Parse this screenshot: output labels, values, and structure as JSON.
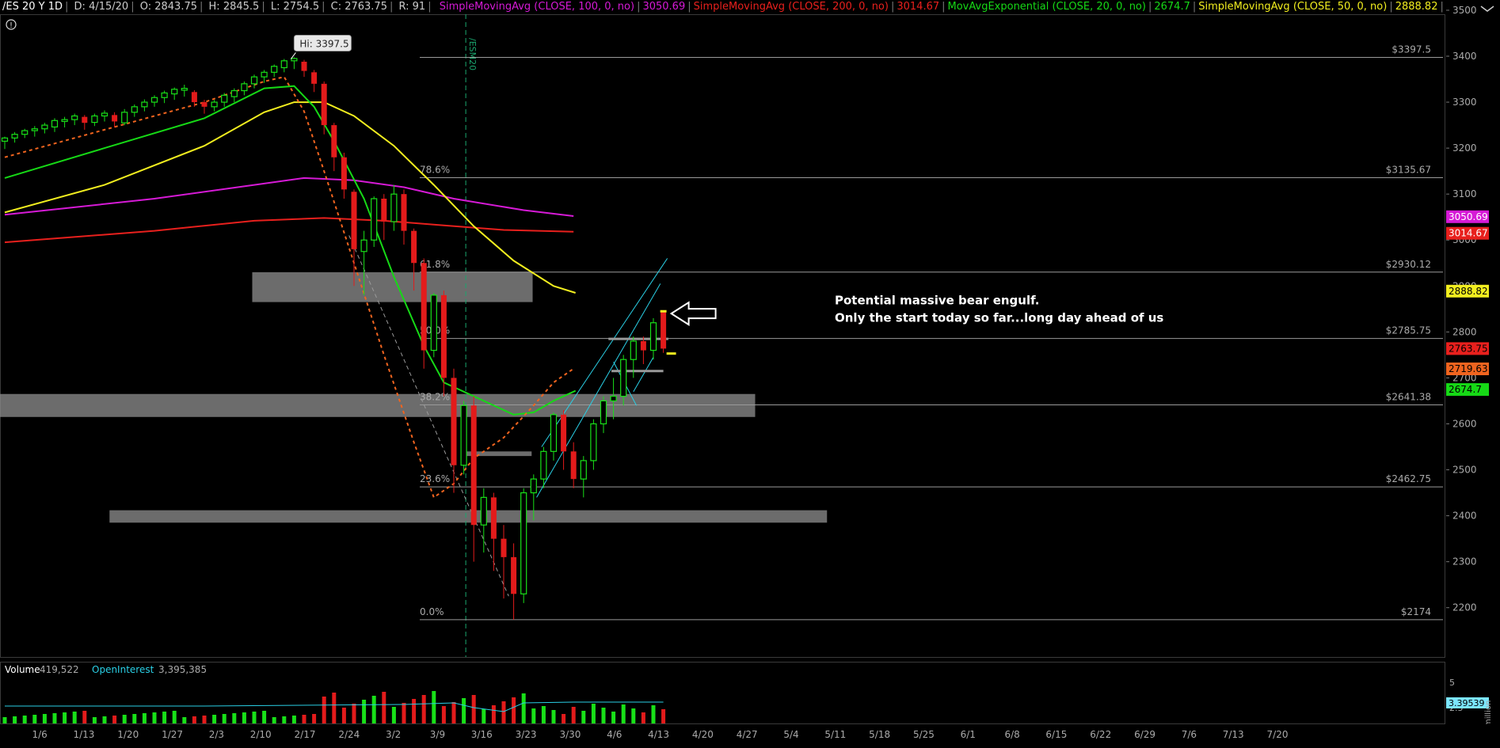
{
  "header": {
    "symbol": "/ES 20 Y 1D",
    "date": "D: 4/15/20",
    "open": "O: 2843.75",
    "high": "H: 2845.5",
    "low": "L: 2754.5",
    "close": "C: 2763.75",
    "range": "R: 91",
    "studies": [
      {
        "label": "SimpleMovingAvg (CLOSE, 100, 0, no)",
        "value": "3050.69",
        "color": "#d61ad6"
      },
      {
        "label": "SimpleMovingAvg (CLOSE, 200, 0, no)",
        "value": "3014.67",
        "color": "#e8201d"
      },
      {
        "label": "MovAvgExponential (CLOSE, 20, 0, no)",
        "value": "2674.7",
        "color": "#16d916"
      },
      {
        "label": "SimpleMovingAvg (CLOSE, 50, 0, no)",
        "value": "2888.82",
        "color": "#f2ee1f"
      },
      {
        "label": "MovAvgExponential (CLOSE, 8, 0, no)",
        "value": "2719.63",
        "color": "#f0641f"
      }
    ]
  },
  "chart_data": {
    "type": "candlestick",
    "x_ticks": [
      "1/6",
      "1/13",
      "1/20",
      "1/27",
      "2/3",
      "2/10",
      "2/17",
      "2/24",
      "3/2",
      "3/9",
      "3/16",
      "3/23",
      "3/30",
      "4/6",
      "4/13",
      "4/20",
      "4/27",
      "5/4",
      "5/11",
      "5/18",
      "5/25",
      "6/1",
      "6/8",
      "6/15",
      "6/22",
      "6/29",
      "7/6",
      "7/13",
      "7/20"
    ],
    "y_ticks": [
      2200,
      2300,
      2400,
      2500,
      2600,
      2700,
      2800,
      2900,
      3000,
      3100,
      3200,
      3300,
      3400,
      3500
    ],
    "ylim": [
      2140,
      3510
    ],
    "high_label": "Hi: 3397.5",
    "contract_label": "/ESM20",
    "fib_levels": [
      {
        "pct": "78.6%",
        "price": 3135.67,
        "label": "$3135.67"
      },
      {
        "pct": "61.8%",
        "price": 2930.12,
        "label": "$2930.12"
      },
      {
        "pct": "50.0%",
        "price": 2785.75,
        "label": "$2785.75"
      },
      {
        "pct": "38.2%",
        "price": 2641.38,
        "label": "$2641.38"
      },
      {
        "pct": "23.6%",
        "price": 2462.75,
        "label": "$2462.75"
      },
      {
        "pct": "0.0%",
        "price": 2174,
        "label": "$2174"
      },
      {
        "pct": "",
        "price": 3397.5,
        "label": "$3397.5"
      }
    ],
    "zones": [
      {
        "x0": 24.8,
        "x1": 52.9,
        "y0": 2865,
        "y1": 2930
      },
      {
        "x0": -0.6,
        "x1": 75.2,
        "y0": 2615,
        "y1": 2665
      },
      {
        "x0": 10.5,
        "x1": 82.4,
        "y0": 2385,
        "y1": 2412
      },
      {
        "x0": 46.1,
        "x1": 52.8,
        "y0": 2530,
        "y1": 2540
      }
    ],
    "price_labels": [
      {
        "text": "3050.69",
        "price": 3050.69,
        "bg": "#d61ad6",
        "fg": "#ffffff"
      },
      {
        "text": "3014.67",
        "price": 3014.67,
        "bg": "#e8201d",
        "fg": "#ffffff"
      },
      {
        "text": "2888.82",
        "price": 2888.82,
        "bg": "#f2ee1f",
        "fg": "#000000"
      },
      {
        "text": "2763.75",
        "price": 2763.75,
        "bg": "#e8201d",
        "fg": "#000000"
      },
      {
        "text": "2719.63",
        "price": 2719.63,
        "bg": "#f0641f",
        "fg": "#000000"
      },
      {
        "text": "2674.7",
        "price": 2674.7,
        "bg": "#16d916",
        "fg": "#000000"
      }
    ],
    "annotation": [
      "Potential massive bear engulf.",
      "Only the start today so far...long day ahead of us"
    ],
    "series": [
      {
        "name": "SMA 100",
        "color": "#d61ad6",
        "points": [
          [
            0,
            3055
          ],
          [
            15,
            3090
          ],
          [
            25,
            3120
          ],
          [
            30,
            3135
          ],
          [
            35,
            3130
          ],
          [
            40,
            3115
          ],
          [
            45,
            3090
          ],
          [
            52,
            3065
          ],
          [
            57,
            3052
          ]
        ]
      },
      {
        "name": "SMA 200",
        "color": "#e8201d",
        "points": [
          [
            0,
            2995
          ],
          [
            15,
            3020
          ],
          [
            25,
            3042
          ],
          [
            32,
            3048
          ],
          [
            38,
            3042
          ],
          [
            44,
            3032
          ],
          [
            50,
            3022
          ],
          [
            57,
            3018
          ]
        ]
      },
      {
        "name": "SMA 50",
        "color": "#f2ee1f",
        "points": [
          [
            0,
            3060
          ],
          [
            10,
            3120
          ],
          [
            20,
            3205
          ],
          [
            26,
            3278
          ],
          [
            29,
            3300
          ],
          [
            32,
            3300
          ],
          [
            35,
            3270
          ],
          [
            39,
            3205
          ],
          [
            43,
            3120
          ],
          [
            47,
            3030
          ],
          [
            51,
            2955
          ],
          [
            55,
            2900
          ],
          [
            57.2,
            2885
          ]
        ]
      },
      {
        "name": "EMA 20",
        "color": "#16d916",
        "points": [
          [
            0,
            3135
          ],
          [
            10,
            3200
          ],
          [
            20,
            3265
          ],
          [
            26,
            3330
          ],
          [
            29,
            3335
          ],
          [
            31,
            3290
          ],
          [
            33,
            3215
          ],
          [
            36,
            3090
          ],
          [
            39,
            2920
          ],
          [
            42,
            2770
          ],
          [
            44,
            2690
          ],
          [
            47,
            2660
          ],
          [
            51,
            2620
          ],
          [
            53,
            2625
          ],
          [
            55,
            2650
          ],
          [
            57.2,
            2672
          ]
        ]
      },
      {
        "name": "EMA 8",
        "color": "#f0641f",
        "points": [
          [
            0,
            3180
          ],
          [
            10,
            3240
          ],
          [
            20,
            3300
          ],
          [
            26,
            3345
          ],
          [
            28,
            3355
          ],
          [
            30,
            3280
          ],
          [
            32,
            3150
          ],
          [
            35,
            2950
          ],
          [
            38,
            2750
          ],
          [
            41,
            2560
          ],
          [
            43,
            2440
          ],
          [
            45,
            2470
          ],
          [
            47,
            2525
          ],
          [
            50,
            2570
          ],
          [
            53,
            2640
          ],
          [
            55,
            2690
          ],
          [
            57,
            2720
          ]
        ]
      }
    ],
    "candles": [
      [
        0,
        3215,
        3222,
        3205,
        3225,
        3198
      ],
      [
        1,
        3222,
        3230,
        3215,
        3235,
        3212
      ],
      [
        2,
        3230,
        3238,
        3226,
        3242,
        3222
      ],
      [
        3,
        3238,
        3242,
        3230,
        3248,
        3225
      ],
      [
        4,
        3242,
        3250,
        3238,
        3255,
        3232
      ],
      [
        5,
        3246,
        3260,
        3240,
        3265,
        3235
      ],
      [
        6,
        3258,
        3262,
        3250,
        3268,
        3245
      ],
      [
        7,
        3262,
        3270,
        3256,
        3275,
        3250
      ],
      [
        8,
        3268,
        3255,
        3248,
        3272,
        3240
      ],
      [
        9,
        3256,
        3270,
        3252,
        3275,
        3248
      ],
      [
        10,
        3270,
        3276,
        3262,
        3282,
        3258
      ],
      [
        11,
        3272,
        3258,
        3250,
        3278,
        3245
      ],
      [
        12,
        3255,
        3278,
        3252,
        3285,
        3250
      ],
      [
        13,
        3278,
        3290,
        3272,
        3295,
        3268
      ],
      [
        14,
        3290,
        3300,
        3284,
        3306,
        3280
      ],
      [
        15,
        3300,
        3310,
        3294,
        3315,
        3290
      ],
      [
        16,
        3310,
        3320,
        3303,
        3325,
        3298
      ],
      [
        17,
        3318,
        3328,
        3312,
        3332,
        3305
      ],
      [
        18,
        3326,
        3330,
        3318,
        3338,
        3312
      ],
      [
        19,
        3322,
        3300,
        3294,
        3326,
        3290
      ],
      [
        20,
        3300,
        3290,
        3280,
        3305,
        3275
      ],
      [
        21,
        3290,
        3300,
        3286,
        3305,
        3280
      ],
      [
        22,
        3300,
        3315,
        3296,
        3320,
        3290
      ],
      [
        23,
        3312,
        3325,
        3306,
        3330,
        3300
      ],
      [
        24,
        3325,
        3340,
        3320,
        3345,
        3315
      ],
      [
        25,
        3340,
        3355,
        3335,
        3360,
        3330
      ],
      [
        26,
        3355,
        3365,
        3348,
        3370,
        3342
      ],
      [
        27,
        3365,
        3378,
        3360,
        3382,
        3355
      ],
      [
        28,
        3375,
        3390,
        3370,
        3394,
        3365
      ],
      [
        29,
        3390,
        3395,
        3380,
        3397.5,
        3372
      ],
      [
        30,
        3388,
        3368,
        3360,
        3392,
        3355
      ],
      [
        31,
        3365,
        3340,
        3330,
        3370,
        3322
      ],
      [
        32,
        3340,
        3250,
        3240,
        3345,
        3230
      ],
      [
        33,
        3250,
        3180,
        3160,
        3255,
        3150
      ],
      [
        34,
        3180,
        3110,
        3100,
        3190,
        3090
      ],
      [
        35,
        3105,
        2980,
        2950,
        3110,
        2900
      ],
      [
        36,
        2975,
        3000,
        2960,
        3020,
        2880
      ],
      [
        37,
        3000,
        3090,
        2990,
        3095,
        2985
      ],
      [
        38,
        3090,
        3040,
        3010,
        3100,
        3000
      ],
      [
        39,
        3040,
        3100,
        3030,
        3120,
        3020
      ],
      [
        40,
        3100,
        3020,
        3000,
        3110,
        2990
      ],
      [
        41,
        3020,
        2950,
        2920,
        3025,
        2890
      ],
      [
        42,
        2950,
        2760,
        2740,
        2960,
        2720
      ],
      [
        43,
        2760,
        2880,
        2750,
        2885,
        2745
      ],
      [
        44,
        2880,
        2700,
        2680,
        2890,
        2660
      ],
      [
        45,
        2700,
        2510,
        2480,
        2720,
        2450
      ],
      [
        46,
        2510,
        2640,
        2500,
        2650,
        2490
      ],
      [
        47,
        2640,
        2380,
        2350,
        2660,
        2300
      ],
      [
        48,
        2380,
        2440,
        2330,
        2460,
        2320
      ],
      [
        49,
        2440,
        2350,
        2300,
        2450,
        2280
      ],
      [
        50,
        2350,
        2310,
        2230,
        2380,
        2220
      ],
      [
        51,
        2310,
        2230,
        2180,
        2340,
        2174
      ],
      [
        52,
        2230,
        2450,
        2220,
        2460,
        2210
      ],
      [
        53,
        2450,
        2480,
        2400,
        2490,
        2390
      ],
      [
        54,
        2480,
        2540,
        2470,
        2550,
        2460
      ],
      [
        55,
        2540,
        2620,
        2530,
        2625,
        2520
      ],
      [
        56,
        2620,
        2540,
        2510,
        2630,
        2500
      ],
      [
        57,
        2540,
        2480,
        2470,
        2560,
        2460
      ],
      [
        58,
        2480,
        2520,
        2460,
        2530,
        2440
      ],
      [
        59,
        2520,
        2600,
        2510,
        2610,
        2500
      ],
      [
        60,
        2600,
        2650,
        2590,
        2660,
        2580
      ],
      [
        61,
        2650,
        2660,
        2620,
        2700,
        2610
      ],
      [
        62,
        2660,
        2740,
        2650,
        2750,
        2640
      ],
      [
        63,
        2740,
        2780,
        2720,
        2790,
        2700
      ],
      [
        64,
        2780,
        2760,
        2740,
        2790,
        2730
      ],
      [
        65,
        2760,
        2820,
        2750,
        2830,
        2740
      ],
      [
        66,
        2843.75,
        2763.75,
        2754.5,
        2845.5,
        2754.5
      ]
    ],
    "volume_header": {
      "label": "Volume",
      "value": "419,522",
      "oi_label": "OpenInterest",
      "oi_value": "3,395,385"
    },
    "volume_axis_label": "3.39539",
    "volume_ticks": [
      "5",
      "2.5"
    ],
    "volume_unit": "million"
  }
}
